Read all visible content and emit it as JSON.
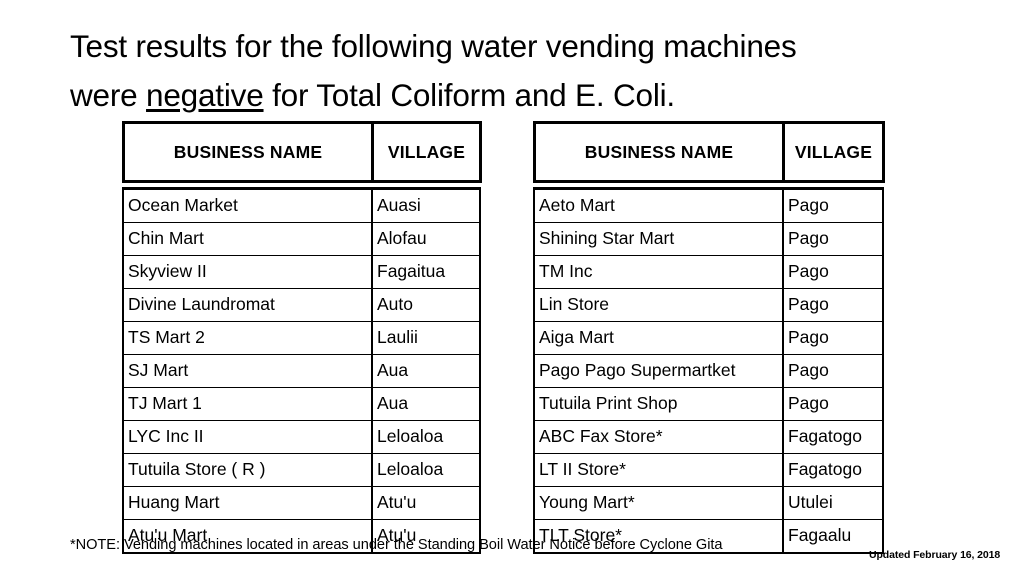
{
  "title": {
    "line1": "Test results for the following water vending machines",
    "line2_before": "were ",
    "line2_underlined": "negative",
    "line2_after": " for Total Coliform and E. Coli."
  },
  "tables": {
    "left": {
      "headers": [
        "BUSINESS NAME",
        "VILLAGE"
      ],
      "rows": [
        [
          "Ocean Market",
          "Auasi"
        ],
        [
          "Chin Mart",
          "Alofau"
        ],
        [
          "Skyview II",
          "Fagaitua"
        ],
        [
          "Divine Laundromat",
          "Auto"
        ],
        [
          "TS Mart 2",
          "Laulii"
        ],
        [
          "SJ Mart",
          "Aua"
        ],
        [
          "TJ Mart 1",
          "Aua"
        ],
        [
          "LYC Inc II",
          "Leloaloa"
        ],
        [
          "Tutuila Store ( R )",
          "Leloaloa"
        ],
        [
          "Huang Mart",
          "Atu'u"
        ],
        [
          "Atu'u Mart",
          "Atu'u"
        ]
      ]
    },
    "right": {
      "headers": [
        "BUSINESS NAME",
        "VILLAGE"
      ],
      "rows": [
        [
          "Aeto Mart",
          "Pago"
        ],
        [
          "Shining Star Mart",
          "Pago"
        ],
        [
          "TM Inc",
          "Pago"
        ],
        [
          "Lin Store",
          "Pago"
        ],
        [
          "Aiga Mart",
          "Pago"
        ],
        [
          "Pago Pago Supermartket",
          "Pago"
        ],
        [
          "Tutuila Print Shop",
          "Pago"
        ],
        [
          "ABC Fax Store*",
          "Fagatogo"
        ],
        [
          "LT II Store*",
          "Fagatogo"
        ],
        [
          "Young Mart*",
          "Utulei"
        ],
        [
          "TLT Store*",
          "Fagaalu"
        ]
      ]
    }
  },
  "footer": {
    "note": "*NOTE: Vending machines located in areas under the Standing Boil Water Notice before Cyclone Gita",
    "updated": "Updated February 16, 2018"
  },
  "colors": {
    "text": "#000000",
    "background": "#ffffff",
    "border": "#000000"
  }
}
